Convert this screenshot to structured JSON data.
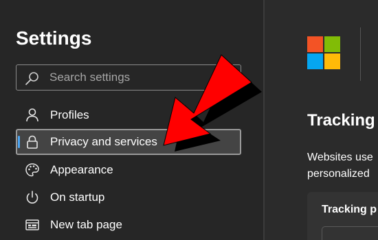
{
  "sidebar": {
    "title": "Settings",
    "search": {
      "placeholder": "Search settings",
      "value": ""
    },
    "items": [
      {
        "label": "Profiles",
        "icon": "person-icon",
        "selected": false
      },
      {
        "label": "Privacy and services",
        "icon": "lock-icon",
        "selected": true
      },
      {
        "label": "Appearance",
        "icon": "palette-icon",
        "selected": false
      },
      {
        "label": "On startup",
        "icon": "power-icon",
        "selected": false
      },
      {
        "label": "New tab page",
        "icon": "new-tab-icon",
        "selected": false
      }
    ]
  },
  "main": {
    "logo": "microsoft-logo",
    "heading": "Tracking",
    "description_lines": [
      "Websites use",
      "personalized"
    ],
    "card_title": "Tracking p"
  },
  "annotation": {
    "icon": "red-arrow-icon",
    "color": "#ff0000"
  },
  "colors": {
    "accent": "#4ba6f5",
    "ms_red": "#f35325",
    "ms_green": "#81bc06",
    "ms_blue": "#05a6f0",
    "ms_yellow": "#ffba08"
  }
}
